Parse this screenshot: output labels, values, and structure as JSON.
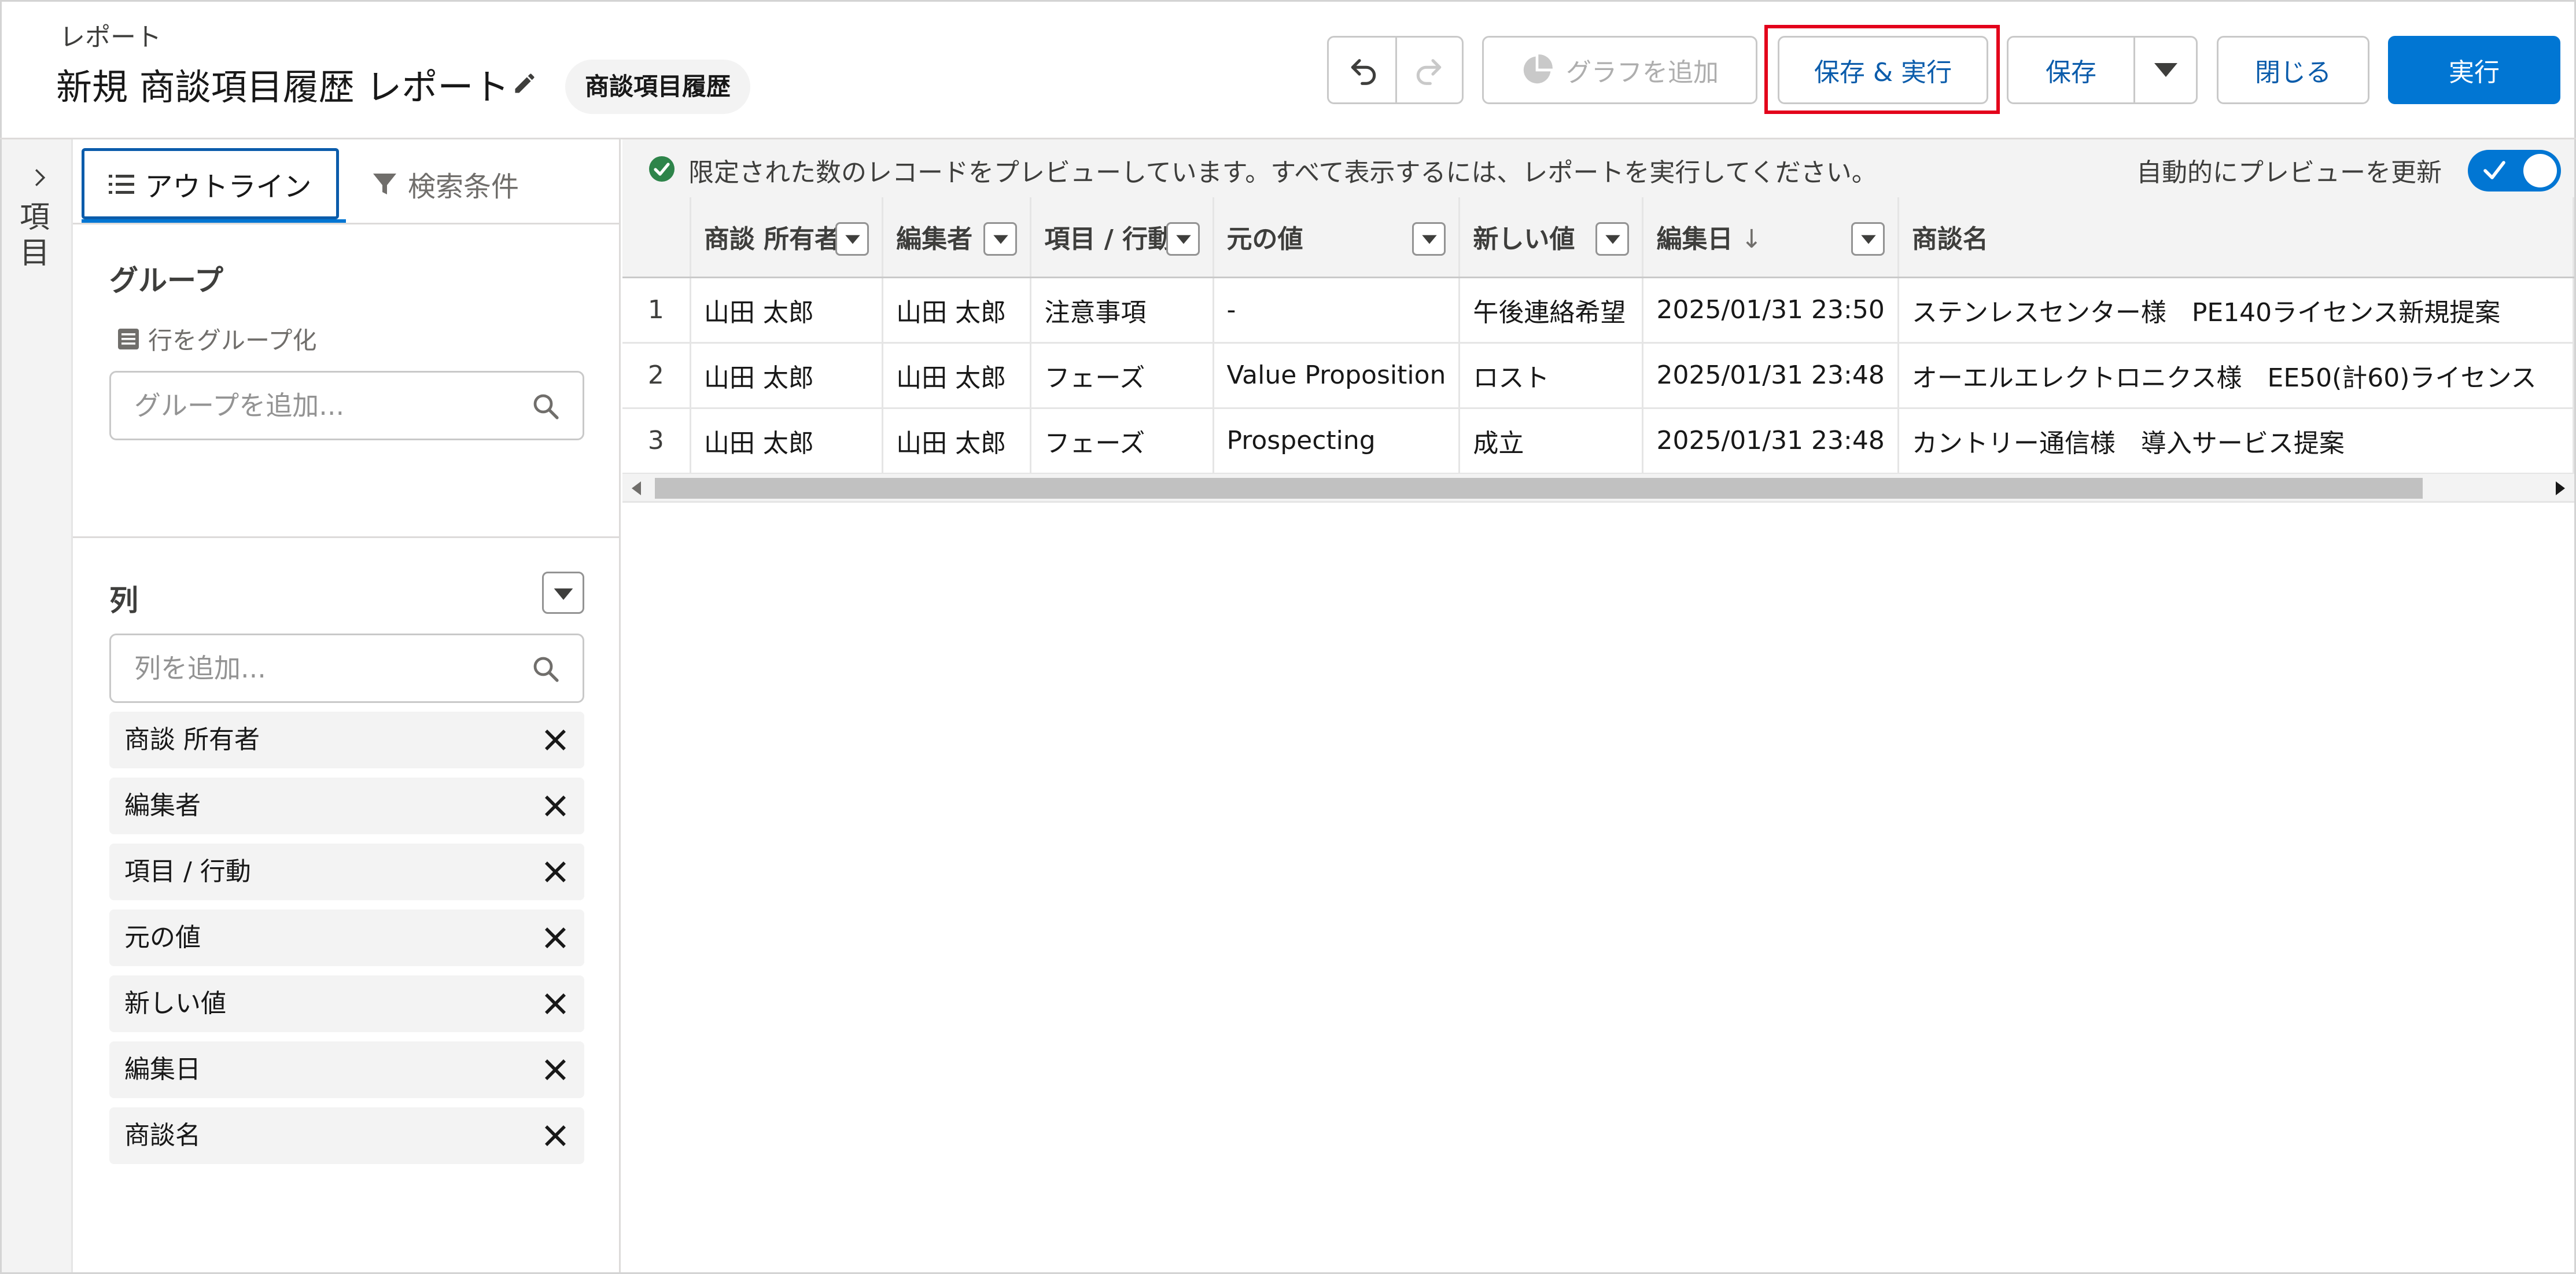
{
  "header": {
    "breadcrumb": "レポート",
    "title": "新規 商談項目履歴 レポート",
    "report_type": "商談項目履歴"
  },
  "toolbar": {
    "add_chart": "グラフを追加",
    "save_run": "保存 & 実行",
    "save": "保存",
    "close": "閉じる",
    "run": "実行"
  },
  "rail": {
    "label": "項目"
  },
  "panel": {
    "tabs": {
      "outline": "アウトライン",
      "filters": "検索条件"
    },
    "group": {
      "title": "グループ",
      "row_group_label": "行をグループ化",
      "search_placeholder": "グループを追加..."
    },
    "columns": {
      "title": "列",
      "search_placeholder": "列を追加...",
      "items": [
        {
          "label": "商談 所有者"
        },
        {
          "label": "編集者"
        },
        {
          "label": "項目 / 行動"
        },
        {
          "label": "元の値"
        },
        {
          "label": "新しい値"
        },
        {
          "label": "編集日"
        },
        {
          "label": "商談名"
        }
      ]
    }
  },
  "preview": {
    "message": "限定された数のレコードをプレビューしています。すべて表示するには、レポートを実行してください。",
    "auto_update_label": "自動的にプレビューを更新",
    "auto_update_on": true
  },
  "table": {
    "headers": [
      "商談 所有者",
      "編集者",
      "項目 / 行動",
      "元の値",
      "新しい値",
      "編集日",
      "商談名"
    ],
    "sort_indicator": "↓",
    "rows": [
      {
        "num": "1",
        "cells": [
          "山田 太郎",
          "山田 太郎",
          "注意事項",
          "-",
          "午後連絡希望",
          "2025/01/31 23:50",
          "ステンレスセンター様　PE140ライセンス新規提案"
        ]
      },
      {
        "num": "2",
        "cells": [
          "山田 太郎",
          "山田 太郎",
          "フェーズ",
          "Value Proposition",
          "ロスト",
          "2025/01/31 23:48",
          "オーエルエレクトロニクス様　EE50(計60)ライセンス"
        ]
      },
      {
        "num": "3",
        "cells": [
          "山田 太郎",
          "山田 太郎",
          "フェーズ",
          "Prospecting",
          "成立",
          "2025/01/31 23:48",
          "カントリー通信様　導入サービス提案"
        ]
      }
    ]
  },
  "colors": {
    "brand": "#0176d3",
    "highlight": "#e3001b",
    "success": "#2e844a"
  }
}
